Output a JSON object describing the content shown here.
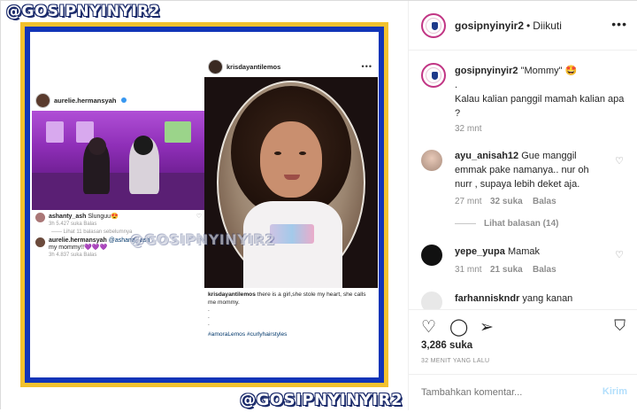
{
  "media": {
    "watermark_top": "@GOSIPNYINYIR2",
    "watermark_mid": "@GOSIPNYINYIR2",
    "watermark_bottom": "@GOSIPNYINYIR2",
    "left_post": {
      "username": "aurelie.hermansyah",
      "comment1_user": "ashanty_ash",
      "comment1_text": "Slunguu😍",
      "comment1_meta": "3h   5.427 suka   Balas",
      "more_replies": "—— Lihat 11 balasan sebelumnya",
      "comment2_user": "aurelie.hermansyah",
      "comment2_mention": "@ashanty_ash",
      "comment2_text": "my mommy!!💜💜💜",
      "comment2_meta": "3h   4.837 suka   Balas"
    },
    "right_post": {
      "username": "krisdayantilemos",
      "caption_user": "krisdayantilemos",
      "caption": "there is a girl,she stole my heart, she calls me mommy.",
      "dots": ".\n.\n.",
      "hashtags": "#amoraLemos #curlyhairstyles"
    }
  },
  "header": {
    "username": "gosipnyinyir2",
    "separator": "•",
    "follow_status": "Diikuti"
  },
  "caption": {
    "username": "gosipnyinyir2",
    "line1": "\"Mommy\" 🤩",
    "line2": ".",
    "line3": "Kalau kalian panggil mamah kalian apa ?",
    "time": "32 mnt"
  },
  "comments": [
    {
      "user": "ayu_anisah12",
      "text": "Gue manggil emmak pake namanya.. nur oh nurr , supaya lebih deket aja.",
      "time": "27 mnt",
      "likes": "32 suka",
      "reply": "Balas",
      "view_replies": "Lihat balasan (14)"
    },
    {
      "user": "yepe_yupa",
      "text": "Mamak",
      "time": "31 mnt",
      "likes": "21 suka",
      "reply": "Balas"
    },
    {
      "user": "farhanniskndr",
      "text": "yang kanan"
    }
  ],
  "actions": {
    "likes": "3,286 suka",
    "date": "32 MENIT YANG LALU"
  },
  "add_comment": {
    "placeholder": "Tambahkan komentar...",
    "post_label": "Kirim"
  },
  "colors": {
    "frame_yellow": "#f2c12e",
    "frame_blue": "#1235b8",
    "link_blue": "#00376b",
    "post_button": "#b2dffc"
  }
}
